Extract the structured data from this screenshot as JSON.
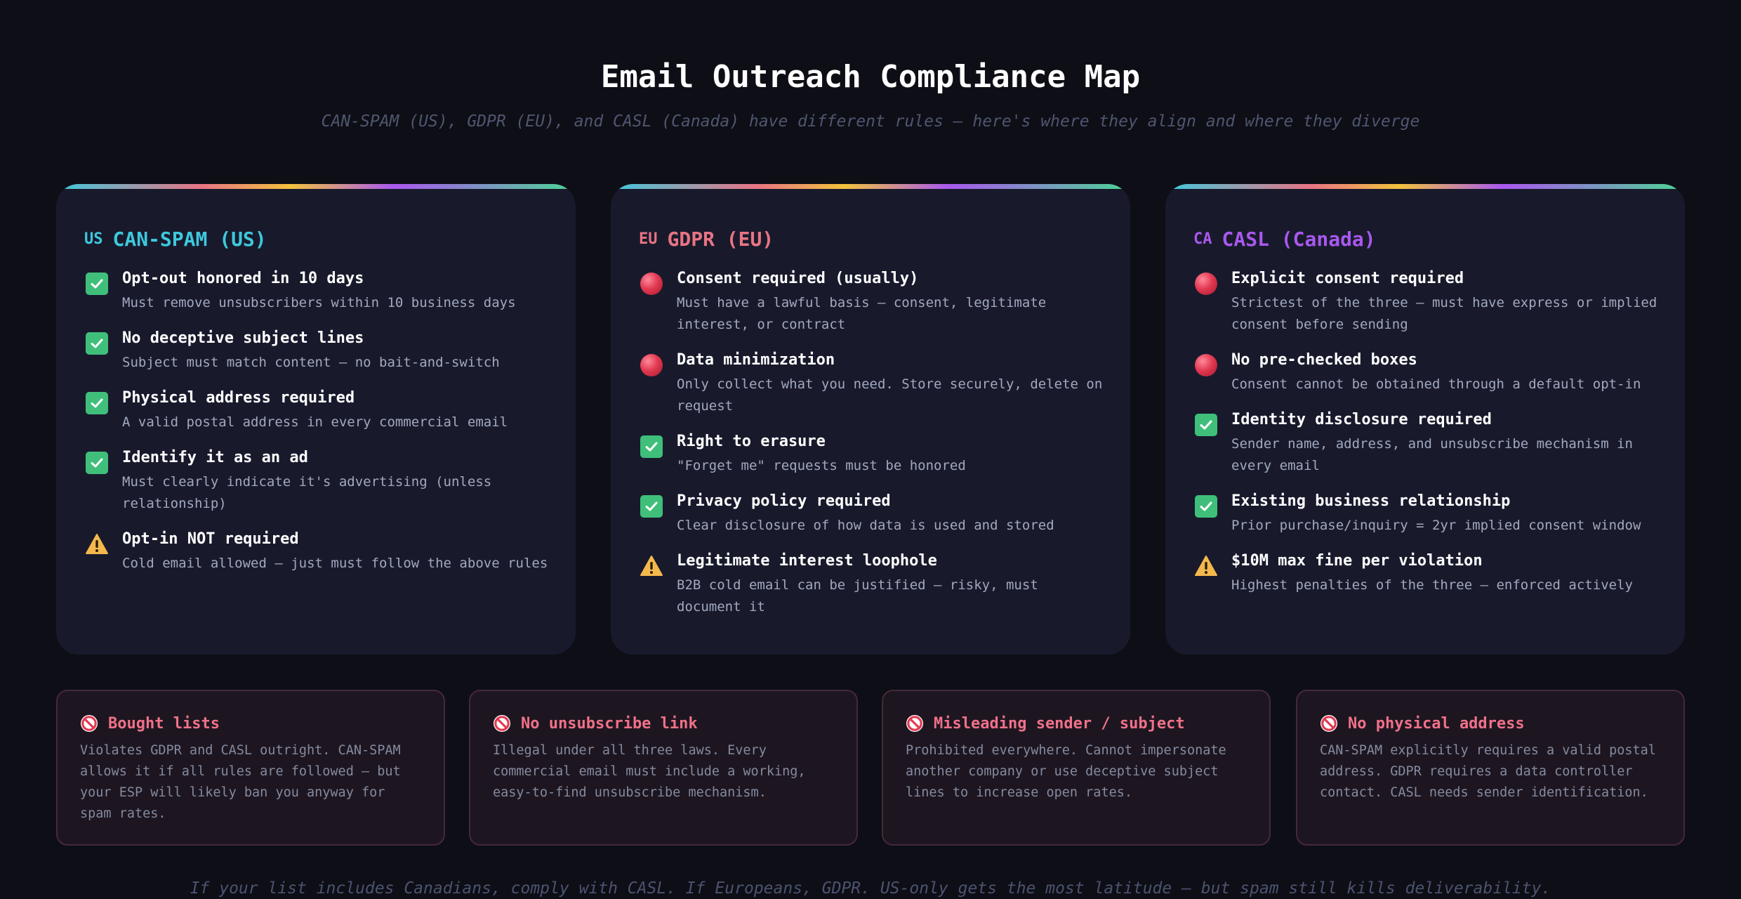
{
  "header": {
    "title": "Email Outreach Compliance Map",
    "subtitle": "CAN-SPAM (US), GDPR (EU), and CASL (Canada) have different rules — here's where they align and where they diverge"
  },
  "colors": {
    "us_accent": "#3ec9dc",
    "eu_accent": "#e87484",
    "ca_accent": "#a958ee",
    "check_green": "#3fbf7a",
    "warning_yellow": "#f4b84c",
    "danger_red": "#e23a52",
    "ban_pink": "#f07189"
  },
  "laws": [
    {
      "code": "US",
      "name": "CAN-SPAM (US)",
      "items": [
        {
          "icon": "check-icon",
          "title": "Opt-out honored in 10 days",
          "desc": "Must remove unsubscribers within 10 business days"
        },
        {
          "icon": "check-icon",
          "title": "No deceptive subject lines",
          "desc": "Subject must match content — no bait-and-switch"
        },
        {
          "icon": "check-icon",
          "title": "Physical address required",
          "desc": "A valid postal address in every commercial email"
        },
        {
          "icon": "check-icon",
          "title": "Identify it as an ad",
          "desc": "Must clearly indicate it's advertising (unless relationship)"
        },
        {
          "icon": "warning-icon",
          "title": "Opt-in NOT required",
          "desc": "Cold email allowed — just must follow the above rules"
        }
      ]
    },
    {
      "code": "EU",
      "name": "GDPR (EU)",
      "items": [
        {
          "icon": "red-dot-icon",
          "title": "Consent required (usually)",
          "desc": "Must have a lawful basis — consent, legitimate interest, or contract"
        },
        {
          "icon": "red-dot-icon",
          "title": "Data minimization",
          "desc": "Only collect what you need. Store securely, delete on request"
        },
        {
          "icon": "check-icon",
          "title": "Right to erasure",
          "desc": "\"Forget me\" requests must be honored"
        },
        {
          "icon": "check-icon",
          "title": "Privacy policy required",
          "desc": "Clear disclosure of how data is used and stored"
        },
        {
          "icon": "warning-icon",
          "title": "Legitimate interest loophole",
          "desc": "B2B cold email can be justified — risky, must document it"
        }
      ]
    },
    {
      "code": "CA",
      "name": "CASL (Canada)",
      "items": [
        {
          "icon": "red-dot-icon",
          "title": "Explicit consent required",
          "desc": "Strictest of the three — must have express or implied consent before sending"
        },
        {
          "icon": "red-dot-icon",
          "title": "No pre-checked boxes",
          "desc": "Consent cannot be obtained through a default opt-in"
        },
        {
          "icon": "check-icon",
          "title": "Identity disclosure required",
          "desc": "Sender name, address, and unsubscribe mechanism in every email"
        },
        {
          "icon": "check-icon",
          "title": "Existing business relationship",
          "desc": "Prior purchase/inquiry = 2yr implied consent window"
        },
        {
          "icon": "warning-icon",
          "title": "$10M max fine per violation",
          "desc": "Highest penalties of the three — enforced actively"
        }
      ]
    }
  ],
  "warnings": [
    {
      "title": "Bought lists",
      "desc": "Violates GDPR and CASL outright. CAN-SPAM allows it if all rules are followed — but your ESP will likely ban you anyway for spam rates."
    },
    {
      "title": "No unsubscribe link",
      "desc": "Illegal under all three laws. Every commercial email must include a working, easy-to-find unsubscribe mechanism."
    },
    {
      "title": "Misleading sender / subject",
      "desc": "Prohibited everywhere. Cannot impersonate another company or use deceptive subject lines to increase open rates."
    },
    {
      "title": "No physical address",
      "desc": "CAN-SPAM explicitly requires a valid postal address. GDPR requires a data controller contact. CASL needs sender identification."
    }
  ],
  "footer": {
    "note": "If your list includes Canadians, comply with CASL. If Europeans, GDPR. US-only gets the most latitude — but spam still kills deliverability."
  }
}
